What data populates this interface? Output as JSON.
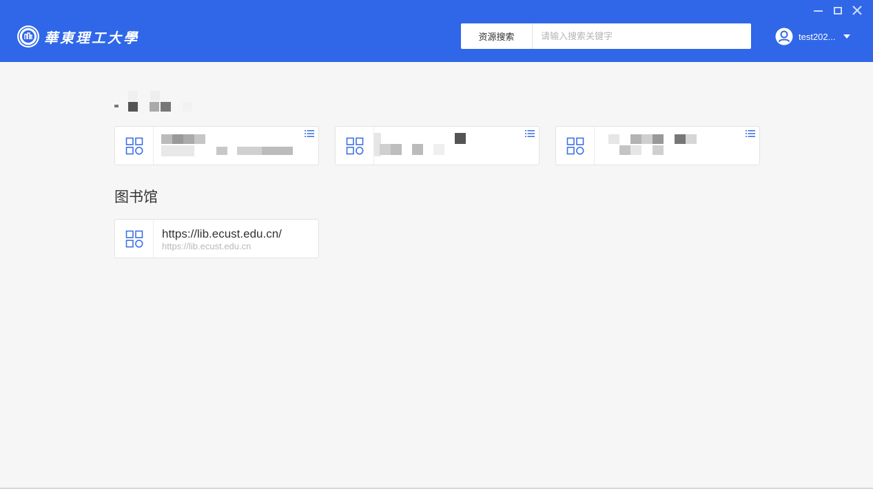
{
  "header": {
    "logo_text": "華東理工大學",
    "search": {
      "type_label": "资源搜索",
      "placeholder": "请输入搜索关键字",
      "value": ""
    },
    "user": {
      "name": "test202..."
    },
    "window_controls": [
      "minimize-icon",
      "maximize-icon",
      "close-icon"
    ]
  },
  "sections": [
    {
      "title": "",
      "title_redacted": true,
      "cards": [
        {
          "title": "",
          "url": "",
          "redacted": true,
          "icon": "apps-grid-icon",
          "has_list_icon": true
        },
        {
          "title": "",
          "url": "",
          "redacted": true,
          "icon": "apps-grid-icon",
          "has_list_icon": true
        },
        {
          "title": "",
          "url": "",
          "redacted": true,
          "icon": "apps-grid-icon",
          "has_list_icon": true
        }
      ]
    },
    {
      "title": "图书馆",
      "cards": [
        {
          "title": "https://lib.ecust.edu.cn/",
          "url": "https://lib.ecust.edu.cn",
          "icon": "apps-grid-icon",
          "has_list_icon": false
        }
      ]
    }
  ],
  "colors": {
    "header_bg": "#2f67e8",
    "page_bg": "#f6f6f6",
    "icon_blue": "#3b6fe6"
  }
}
